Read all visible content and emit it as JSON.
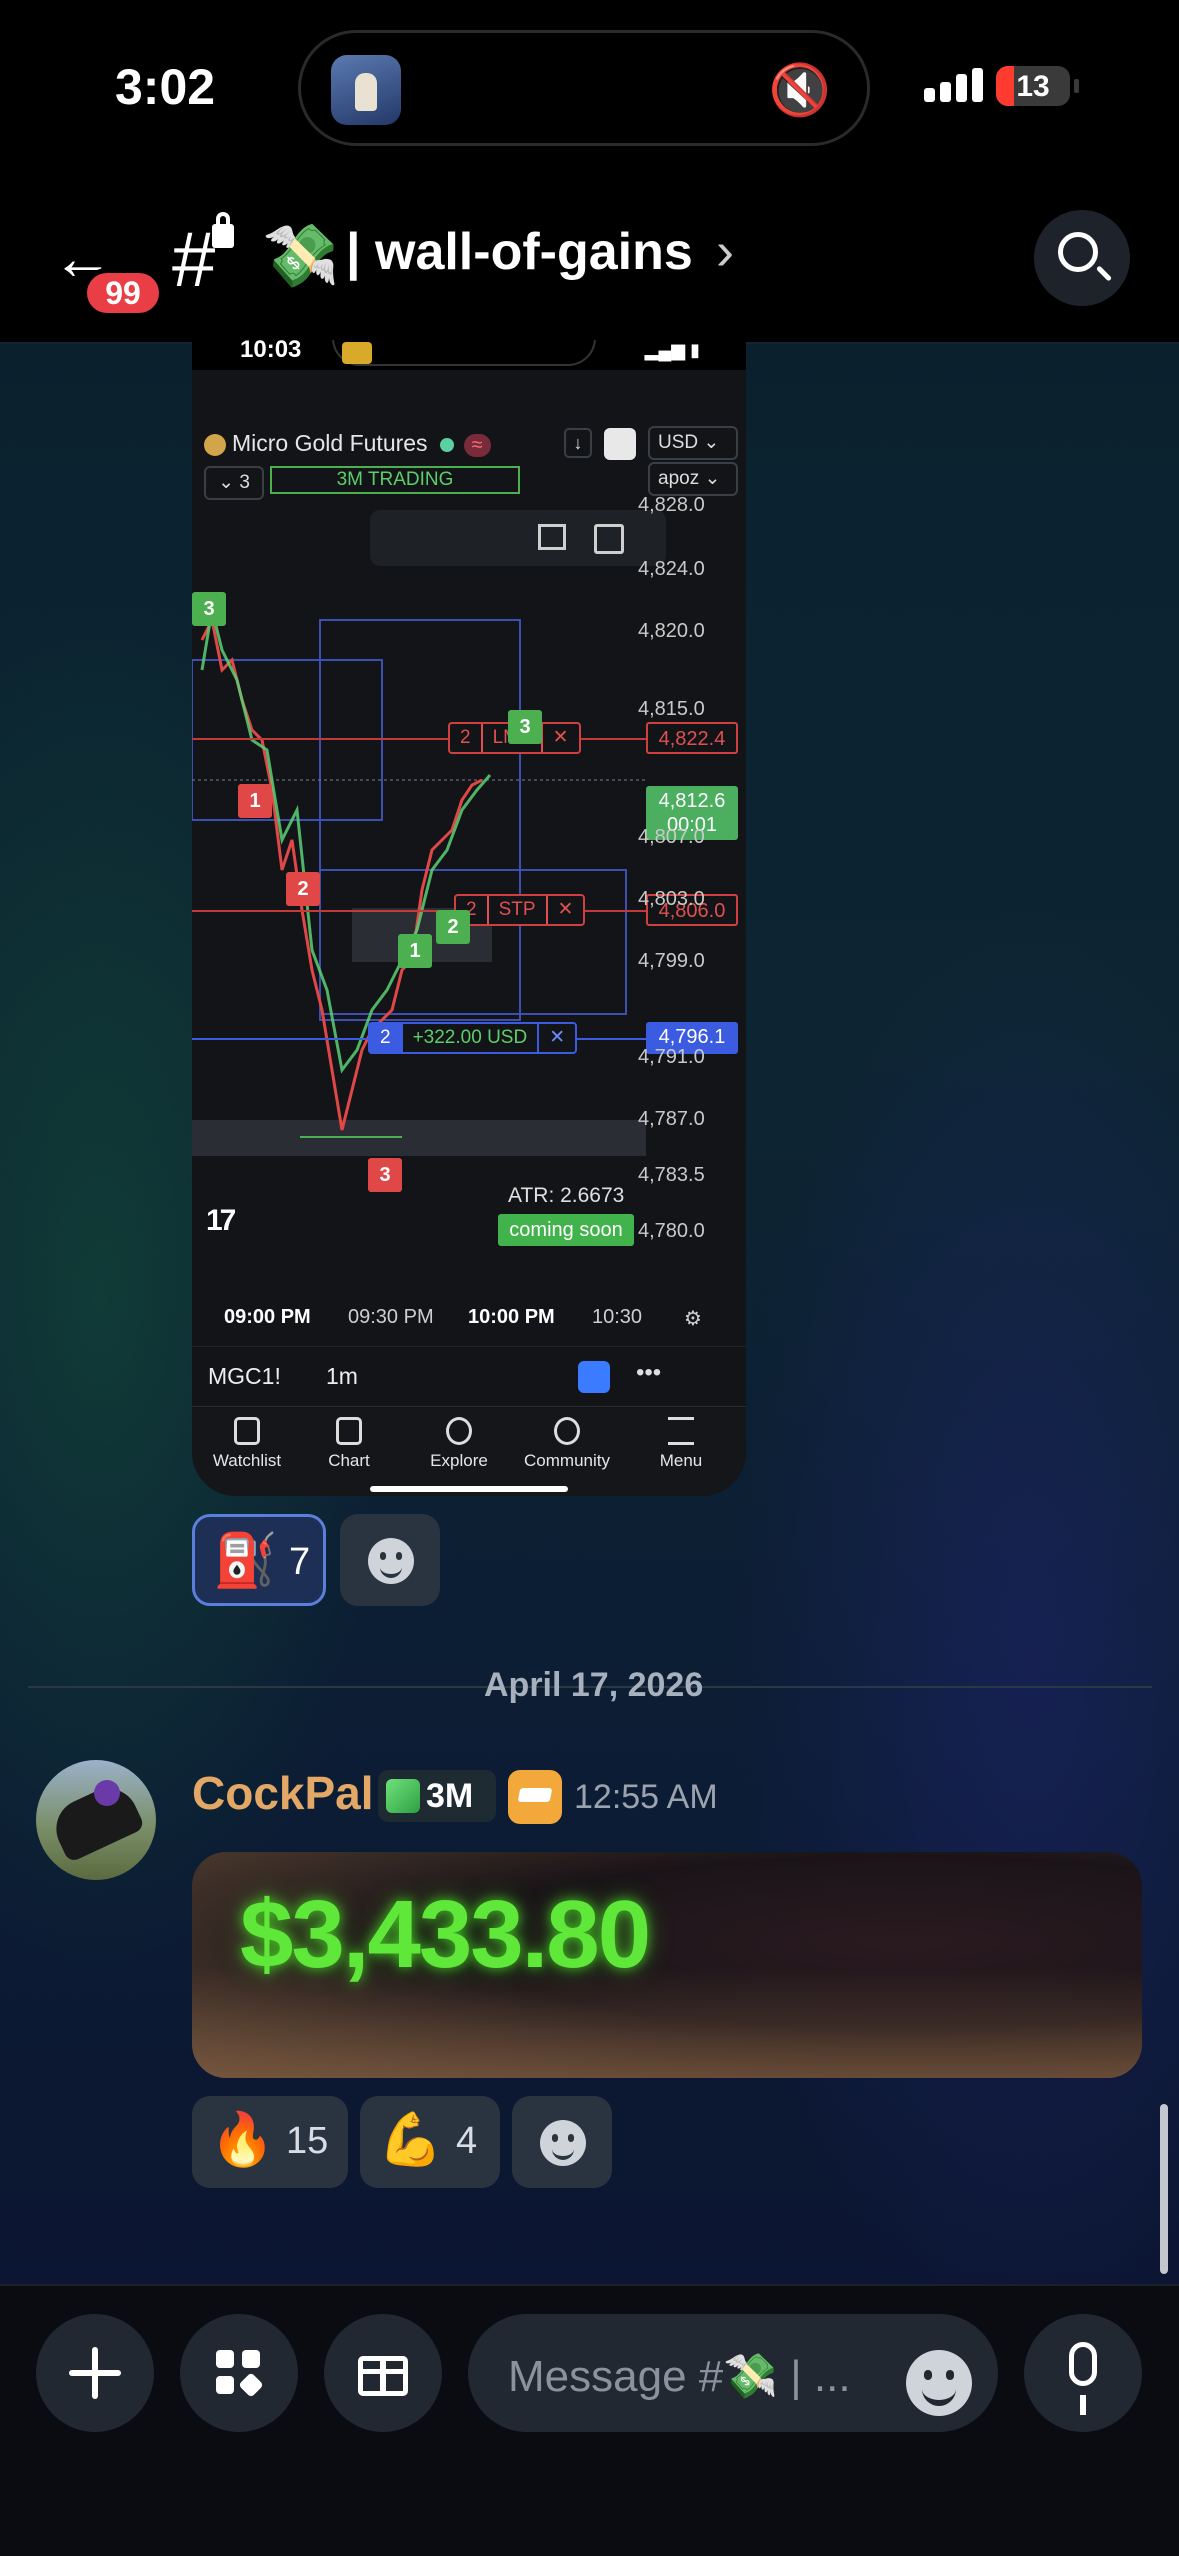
{
  "status_bar": {
    "time": "3:02",
    "battery": "13"
  },
  "header": {
    "unread_badge": "99",
    "channel_icon_emoji": "💸",
    "channel_name": "| wall-of-gains",
    "channel_chevron": "›"
  },
  "embedded_screenshot": {
    "status_time": "10:03",
    "symbol_title": "Micro Gold Futures",
    "trading_label": "3M TRADING",
    "layout_select": "3",
    "currency": "USD",
    "account": "apoz",
    "price_axis": [
      "4,828.0",
      "4,824.0",
      "4,820.0",
      "4,815.0",
      "4,807.0",
      "4,803.0",
      "4,799.0",
      "4,795.0",
      "4,791.0",
      "4,787.0",
      "4,783.5",
      "4,780.0"
    ],
    "orders": {
      "limit": {
        "qty": "2",
        "type": "LMT",
        "price": "4,822.4"
      },
      "stop": {
        "qty": "2",
        "type": "STP",
        "price": "4,806.0"
      },
      "position": {
        "qty": "2",
        "pnl": "+322.00 USD",
        "price": "4,796.1"
      }
    },
    "last_price": "4,812.6",
    "countdown": "00:01",
    "flags": [
      "3",
      "1",
      "2",
      "2",
      "1",
      "3",
      "3"
    ],
    "atr_label": "ATR: 2.6673",
    "coming_soon": "coming soon",
    "time_axis": [
      "09:00 PM",
      "09:30 PM",
      "10:00 PM",
      "10:30"
    ],
    "bottom_symbol": "MGC1!",
    "bottom_timeframe": "1m",
    "tabs": [
      "Watchlist",
      "Chart",
      "Explore",
      "Community",
      "Menu"
    ]
  },
  "reactions_1": [
    {
      "emoji": "⛽",
      "count": "7",
      "active": true
    }
  ],
  "date_divider": "April 17, 2026",
  "message": {
    "author": "CockPal",
    "role_tag": "3M",
    "timestamp": "12:55 AM",
    "image_text": "$3,433.80"
  },
  "reactions_2": [
    {
      "emoji": "🔥",
      "count": "15"
    },
    {
      "emoji": "💪",
      "count": "4"
    }
  ],
  "composer": {
    "placeholder": "Message #💸 | ..."
  },
  "colors": {
    "accent_green": "#5fe83a",
    "username": "#e3a866",
    "badge_red": "#e93e46"
  }
}
